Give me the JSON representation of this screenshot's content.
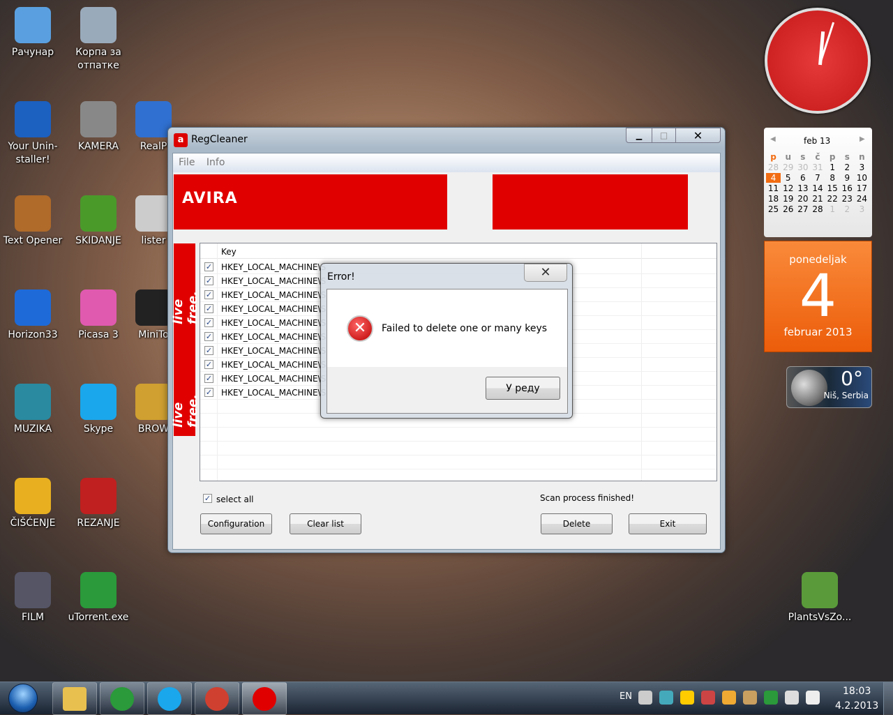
{
  "desktop_icons": [
    {
      "label": "Рачунар"
    },
    {
      "label": "Корпа за отпатке"
    },
    {
      "label": "Your Unin-staller!"
    },
    {
      "label": "KAMERA"
    },
    {
      "label": "RealP"
    },
    {
      "label": "Text Opener"
    },
    {
      "label": "SKIDANJE"
    },
    {
      "label": "lister"
    },
    {
      "label": "Horizon33"
    },
    {
      "label": "Picasa 3"
    },
    {
      "label": "MiniTo"
    },
    {
      "label": "MUZIKA"
    },
    {
      "label": "Skype"
    },
    {
      "label": "BROW"
    },
    {
      "label": "ČIŠĆENJE"
    },
    {
      "label": "REZANJE"
    },
    {
      "label": "FILM"
    },
    {
      "label": "uTorrent.exe"
    },
    {
      "label": "PlantsVsZo..."
    }
  ],
  "window": {
    "title": "RegCleaner",
    "menu": [
      "File",
      "Info"
    ],
    "brand": "AVIRA",
    "side_text": "live free.",
    "column_header": "Key",
    "key_prefix": "HKEY_LOCAL_MACHINE\\S",
    "row_count": 10,
    "select_all": "select all",
    "status": "Scan process finished!",
    "buttons": {
      "configuration": "Configuration",
      "clear": "Clear list",
      "delete": "Delete",
      "exit": "Exit"
    }
  },
  "dialog": {
    "title": "Error!",
    "message": "Failed to delete one or many keys",
    "ok": "У реду"
  },
  "calendar": {
    "month": "feb 13",
    "days": [
      "p",
      "u",
      "s",
      "č",
      "p",
      "s",
      "n"
    ],
    "weeks": [
      [
        "28",
        "29",
        "30",
        "31",
        "1",
        "2",
        "3"
      ],
      [
        "4",
        "5",
        "6",
        "7",
        "8",
        "9",
        "10"
      ],
      [
        "11",
        "12",
        "13",
        "14",
        "15",
        "16",
        "17"
      ],
      [
        "18",
        "19",
        "20",
        "21",
        "22",
        "23",
        "24"
      ],
      [
        "25",
        "26",
        "27",
        "28",
        "1",
        "2",
        "3"
      ]
    ],
    "today": "4"
  },
  "date_tile": {
    "weekday": "ponedeljak",
    "day": "4",
    "month": "februar 2013"
  },
  "weather": {
    "temp": "0°",
    "location": "Niš, Serbia"
  },
  "tray": {
    "lang": "EN",
    "time": "18:03",
    "date": "4.2.2013"
  },
  "colors": {
    "avira_red": "#e00000",
    "orange": "#f26c12"
  }
}
